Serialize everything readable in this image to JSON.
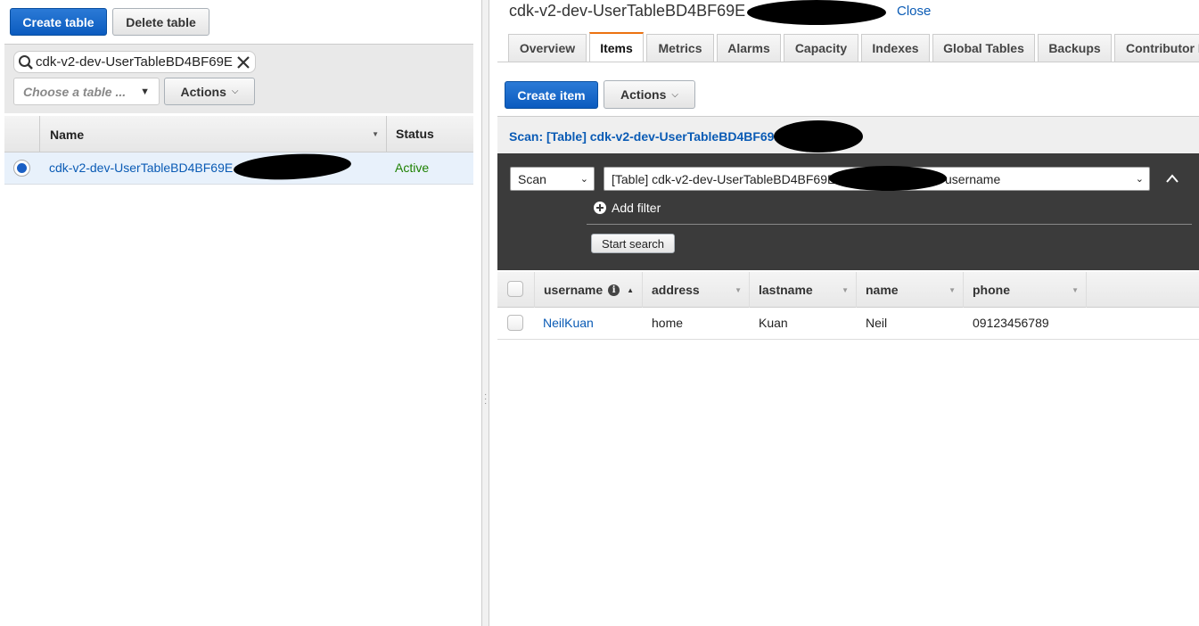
{
  "left": {
    "create_table": "Create table",
    "delete_table": "Delete table",
    "search_value": "cdk-v2-dev-UserTableBD4BF69E",
    "choose_table_placeholder": "Choose a table ...",
    "actions": "Actions",
    "columns": {
      "name": "Name",
      "status": "Status"
    },
    "rows": [
      {
        "name": "cdk-v2-dev-UserTableBD4BF69E",
        "status": "Active",
        "selected": true
      }
    ]
  },
  "right": {
    "title": "cdk-v2-dev-UserTableBD4BF69E",
    "close": "Close",
    "tabs": [
      "Overview",
      "Items",
      "Metrics",
      "Alarms",
      "Capacity",
      "Indexes",
      "Global Tables",
      "Backups",
      "Contributor I"
    ],
    "active_tab": "Items",
    "create_item": "Create item",
    "actions": "Actions",
    "scan_header": "Scan: [Table] cdk-v2-dev-UserTableBD4BF69E",
    "scan_mode": "Scan",
    "scan_target_prefix": "[Table] cdk-v2-dev-UserTableBD4BF69E",
    "scan_target_suffix": "username",
    "add_filter": "Add filter",
    "start_search": "Start search",
    "columns": [
      "username",
      "address",
      "lastname",
      "name",
      "phone"
    ],
    "rows": [
      [
        "NeilKuan",
        "home",
        "Kuan",
        "Neil",
        "09123456789"
      ]
    ]
  },
  "colors": {
    "primary": "#0b5bbf",
    "link": "#0a5bb5",
    "active": "#1d8102",
    "tab_accent": "#ec7211",
    "scan_panel": "#3b3b3b"
  }
}
